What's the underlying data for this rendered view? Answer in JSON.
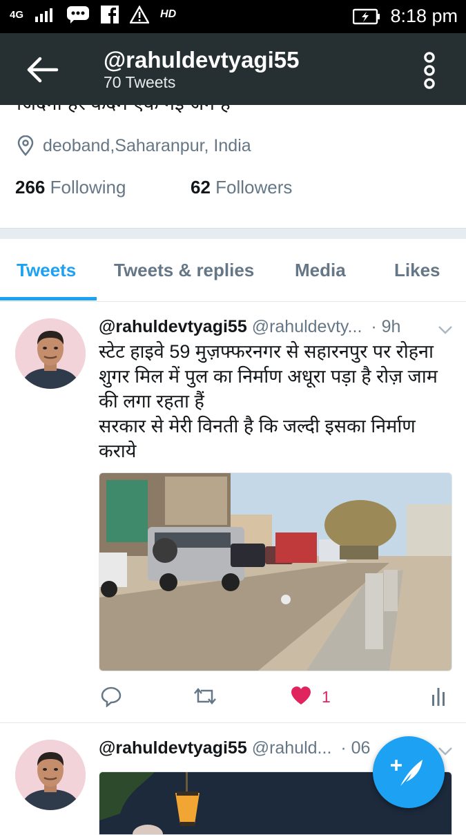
{
  "status_bar": {
    "network": "4G",
    "hd_badge": "HD",
    "time": "8:18 pm",
    "icons": [
      "signal-icon",
      "messages-icon",
      "facebook-icon",
      "warning-icon",
      "battery-charging-icon"
    ]
  },
  "app_bar": {
    "title": "@rahuldevtyagi55",
    "subtitle": "70 Tweets"
  },
  "profile": {
    "bio": "जिंदगी हर कदम एक नई जंग है",
    "location": "deoband,Saharanpur, India",
    "following_count": "266",
    "following_label": "Following",
    "followers_count": "62",
    "followers_label": "Followers"
  },
  "tabs": [
    "Tweets",
    "Tweets & replies",
    "Media",
    "Likes"
  ],
  "tweets": [
    {
      "name": "@rahuldevtyagi55",
      "handle": "@rahuldevty...",
      "time": "· 9h",
      "text": "स्टेट हाइवे 59 मुज़फ्फरनगर से सहारनपुर पर रोहना शुगर मिल में पुल का निर्माण अधूरा पड़ा है रोज़ जाम की लगा रहता हैं\nसरकार से मेरी विनती है कि जल्दी इसका निर्माण कराये",
      "like_count": "1"
    },
    {
      "name": "@rahuldevtyagi55",
      "handle": "@rahuld...",
      "time": "· 06"
    }
  ],
  "colors": {
    "app_bar": "#263032",
    "accent": "#1da1f2",
    "like": "#e0245e",
    "secondary_text": "#657786"
  }
}
